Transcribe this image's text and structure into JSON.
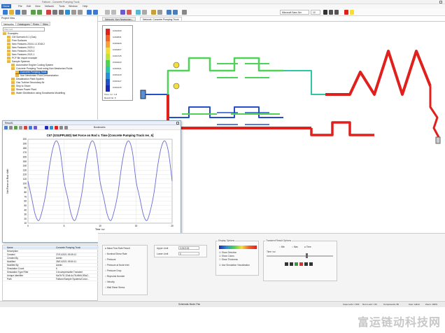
{
  "window": {
    "title": "Fathom - Concrete Pumping Truck"
  },
  "menu": [
    "Home",
    "File",
    "Edit",
    "View",
    "Network",
    "Tools",
    "Window",
    "Help"
  ],
  "toolbar": {
    "font": "Microsoft Sans Ser",
    "font_size": "10"
  },
  "sidebar": {
    "title": "Project View",
    "tabs": [
      "Networks",
      "Catalogues",
      "Roles",
      "Sites"
    ],
    "search_placeholder": "Filter text",
    "tree": [
      "Examples",
      "CM Scenario 8.1 (Gas)",
      "Free Surfaces",
      "New Features 2018.1 & 2018.2",
      "New Features 2020.1",
      "New Features 2020.2",
      "New Features 2021.1",
      "PCF file import example",
      "Sample Systems",
      "Automotive Engine Cooling System",
      "Concrete Pumping Truck using Non Newtonian Fluids",
      "Concrete Pumping Truck",
      "Non Newtonian Fluid Demonstration",
      "Desalination Plant System",
      "Gas Turbine Secondary Air",
      "Ship to Shore",
      "Steam Power Plant",
      "Water Distribution using Snowbanks Modelling"
    ]
  },
  "doc_tabs": [
    "Network: Non Newtonian...",
    "Network: Concrete Pumping Truck"
  ],
  "legend": {
    "values": [
      "0.002133",
      "0.002031",
      "0.001929",
      "0.001827",
      "0.001725",
      "0.001623",
      "0.001521",
      "0.001419",
      "0.001317",
      "0.001215"
    ],
    "colors": [
      "#e0201c",
      "#f3602a",
      "#f6a13b",
      "#f4df3a",
      "#bde33e",
      "#4fd257",
      "#2fc6a7",
      "#2a8fd4",
      "#2350c8",
      "#1e2bb0"
    ],
    "time_label": "Time <s>: 1.8",
    "result_label": "Result No: 6"
  },
  "result_window": {
    "title": "Result1",
    "toolbar_label": "Bookmarks",
    "chart_title": "C67 (GSUPPLIED) Net Force on Rod v. Time [Concrete Pumping Truck res_6]"
  },
  "chart_data": {
    "type": "line",
    "title": "C67 (GSUPPLIED) Net Force on Rod v. Time [Concrete Pumping Truck res_6]",
    "xlabel": "Time <s>",
    "ylabel": "Net Force on Rod <lbf>",
    "xlim": [
      0,
      20
    ],
    "ylim": [
      10,
      200
    ],
    "x_ticks": [
      "0",
      "5",
      "10",
      "15",
      "20"
    ],
    "y_ticks": [
      "10",
      "20",
      "30",
      "40",
      "50",
      "60",
      "70",
      "80",
      "90",
      "100",
      "110",
      "120",
      "130",
      "140",
      "150",
      "160",
      "170",
      "180",
      "190",
      "200"
    ],
    "series": [
      {
        "color": "#6b6bd6",
        "x": [
          0,
          0.5,
          1,
          1.5,
          2,
          2.5,
          3,
          3.5,
          4,
          4.5,
          5,
          5.5,
          6,
          6.5,
          7,
          7.5,
          8,
          8.5,
          9,
          9.5,
          10,
          10.5,
          11,
          11.5,
          12,
          12.5,
          13,
          13.5,
          14,
          14.5,
          15,
          15.5,
          16,
          16.5,
          17,
          17.5,
          18,
          18.5,
          19,
          19.5,
          20
        ],
        "y": [
          105,
          68,
          30,
          16,
          40,
          80,
          140,
          182,
          196,
          170,
          105,
          68,
          30,
          16,
          40,
          80,
          140,
          182,
          196,
          170,
          105,
          68,
          30,
          16,
          40,
          80,
          140,
          182,
          196,
          170,
          105,
          68,
          30,
          16,
          40,
          80,
          140,
          182,
          196,
          170,
          105
        ]
      }
    ]
  },
  "properties": {
    "rows": [
      {
        "k": "Name",
        "v": "Concrete Pumping Truck"
      },
      {
        "k": "Description",
        "v": ""
      },
      {
        "k": "Created",
        "v": "27/01/2021 09:35:12"
      },
      {
        "k": "Created By",
        "v": "Admin"
      },
      {
        "k": "Modified",
        "v": "28/01/2021 09:50:11"
      },
      {
        "k": "Modified By",
        "v": "Admin"
      },
      {
        "k": "Simulation Count",
        "v": "6"
      },
      {
        "k": "Simulation Type Filter",
        "v": "3 Incompressible Transient"
      },
      {
        "k": "Unique Identifier",
        "v": "f4a7b7f1-32a6-4c78-b5b5-2f3a2..."
      },
      {
        "k": "Path",
        "v": "Fathom/Sample Systems/Concr..."
      }
    ]
  },
  "panels": {
    "results": {
      "items": [
        "Mass Flow Rate Result",
        "Nominal Shear Rate",
        "Pressure",
        "Pressure at Node Inlet",
        "Pressure Drop",
        "Reynolds Number",
        "Velocity",
        "Wall Shear Stress"
      ]
    },
    "limits": {
      "upper_label": "Upper Limit",
      "upper_value": "0.002133",
      "lower_label": "Lower Limit",
      "lower_value": "0"
    },
    "display": {
      "title": "Display Options",
      "items": [
        "Show Direction",
        "Show Colors",
        "Show Thickness",
        "Use Simulation Visualization"
      ]
    },
    "transient": {
      "title": "Transient Result Options",
      "time_label": "Time <s>",
      "radio": [
        "Min",
        "Max",
        "Time"
      ]
    }
  },
  "status": {
    "center": "Schematic Mode: Pan",
    "caps": "Caps Lock = OFF",
    "num": "Num Lock = ON",
    "components": "Components: 80",
    "user": "User: Admin",
    "zoom": "Zoom: 100%"
  },
  "watermark": "富运链动科技网"
}
